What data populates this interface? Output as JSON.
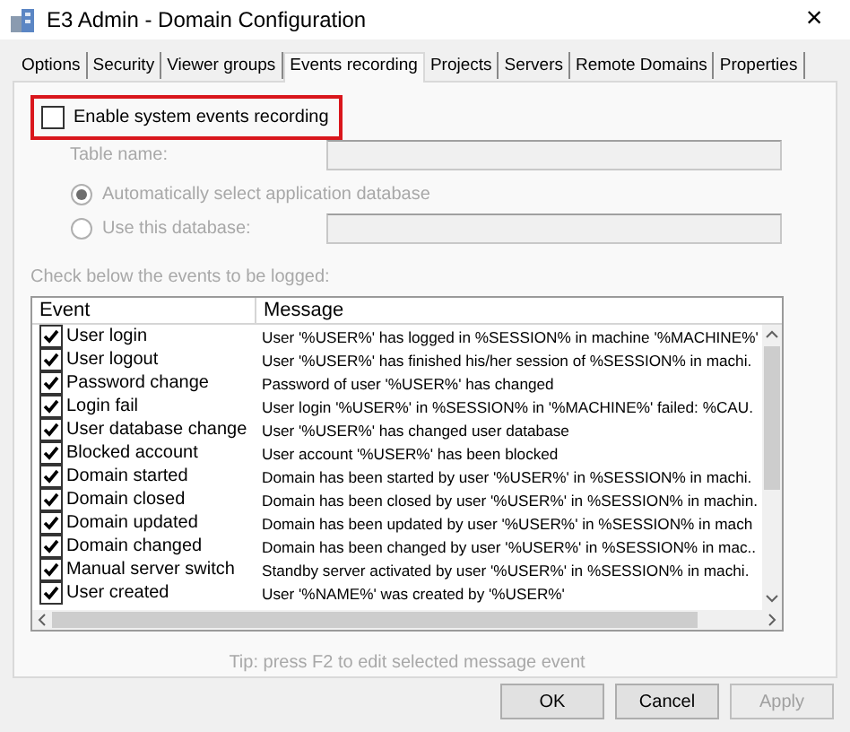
{
  "window": {
    "title": "E3 Admin - Domain Configuration",
    "close": "×"
  },
  "tabs": [
    {
      "label": "Options",
      "selected": false
    },
    {
      "label": "Security",
      "selected": false
    },
    {
      "label": "Viewer groups",
      "selected": false
    },
    {
      "label": "Events recording",
      "selected": true
    },
    {
      "label": "Projects",
      "selected": false
    },
    {
      "label": "Servers",
      "selected": false
    },
    {
      "label": "Remote Domains",
      "selected": false
    },
    {
      "label": "Properties",
      "selected": false
    }
  ],
  "enable_recording": {
    "label": "Enable system events recording",
    "checked": false,
    "highlighted": true
  },
  "table_name": {
    "label": "Table name:",
    "disabled": true
  },
  "database_options": [
    {
      "label": "Automatically select application database",
      "selected": true,
      "disabled": true
    },
    {
      "label": "Use this database:",
      "selected": false,
      "disabled": true
    }
  ],
  "events_hint": "Check below the events to be logged:",
  "table": {
    "columns": [
      "Event",
      "Message"
    ],
    "rows": [
      {
        "event": "User login",
        "message": "User '%USER%' has logged in %SESSION% in machine '%MACHINE%'",
        "checked": true
      },
      {
        "event": "User logout",
        "message": "User '%USER%' has finished his/her session of %SESSION% in machi.",
        "checked": true
      },
      {
        "event": "Password change",
        "message": "Password of user '%USER%' has changed",
        "checked": true
      },
      {
        "event": "Login fail",
        "message": "User login '%USER%' in %SESSION% in '%MACHINE%' failed: %CAU.",
        "checked": true
      },
      {
        "event": "User database change",
        "message": "User '%USER%' has changed user database",
        "checked": true
      },
      {
        "event": "Blocked account",
        "message": "User account '%USER%' has been blocked",
        "checked": true
      },
      {
        "event": "Domain started",
        "message": "Domain has been started by user '%USER%' in %SESSION% in machi.",
        "checked": true
      },
      {
        "event": "Domain closed",
        "message": "Domain has been closed by user '%USER%' in %SESSION% in machin.",
        "checked": true
      },
      {
        "event": "Domain updated",
        "message": "Domain has been updated by user '%USER%' in %SESSION% in mach",
        "checked": true
      },
      {
        "event": "Domain changed",
        "message": "Domain has been changed by user '%USER%' in %SESSION% in mac..",
        "checked": true
      },
      {
        "event": "Manual server switch",
        "message": "Standby server activated by user '%USER%' in %SESSION% in machi.",
        "checked": true
      },
      {
        "event": "User created",
        "message": "User '%NAME%' was created by '%USER%'",
        "checked": true
      }
    ]
  },
  "tip": "Tip: press F2 to edit selected message event",
  "buttons": [
    {
      "label": "OK",
      "disabled": false
    },
    {
      "label": "Cancel",
      "disabled": false
    },
    {
      "label": "Apply",
      "disabled": true
    }
  ]
}
